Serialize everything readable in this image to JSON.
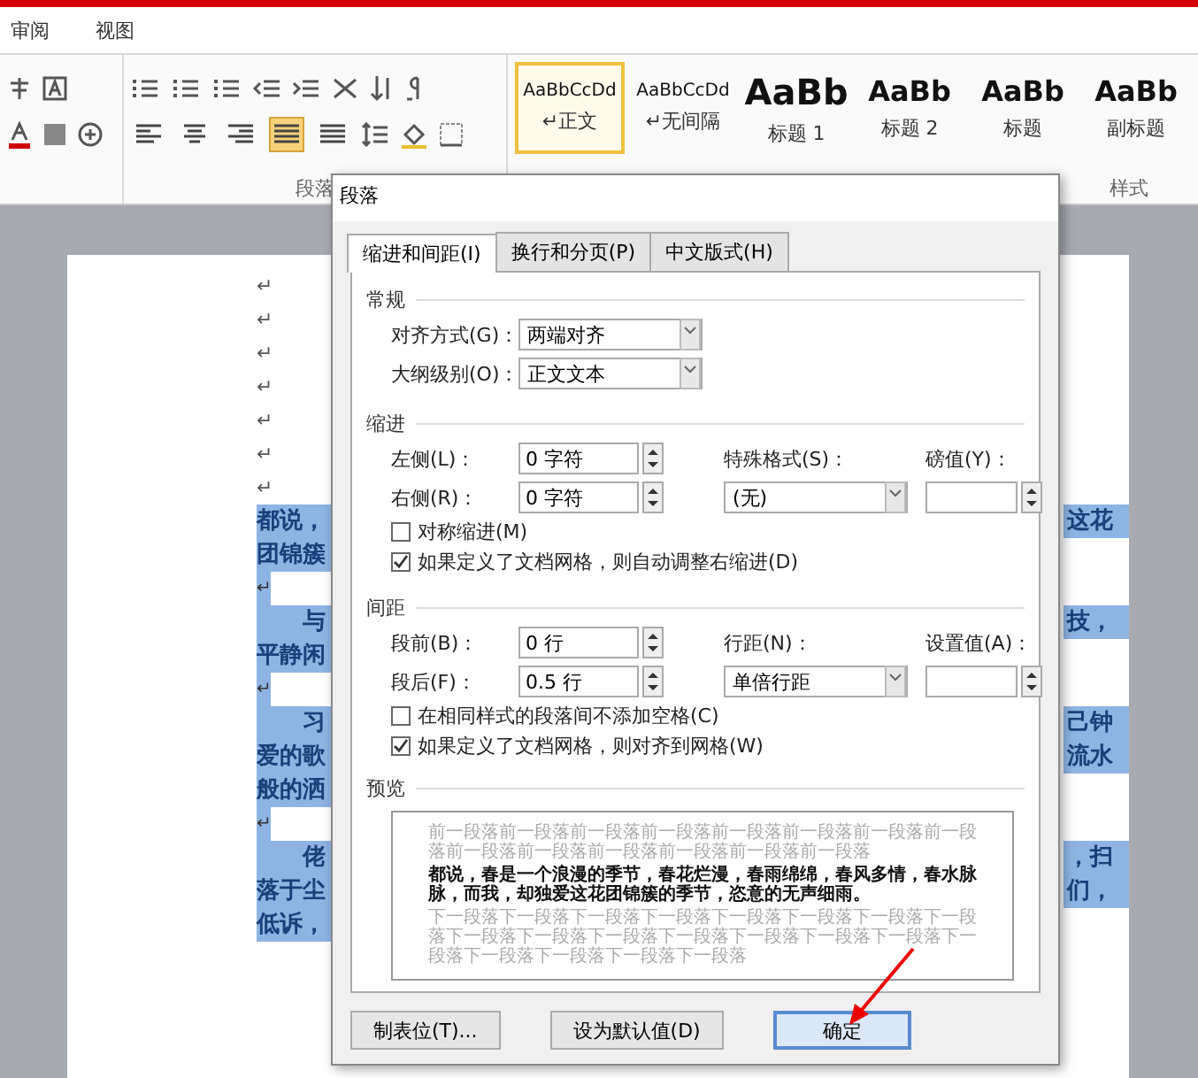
{
  "menu_tabs": [
    {
      "label": "审阅",
      "selected": false
    },
    {
      "label": "视图",
      "selected": false
    }
  ],
  "ribbon": {
    "alignment_buttons": [
      {
        "selected": false
      },
      {
        "selected": false
      },
      {
        "selected": false
      },
      {
        "selected": true
      },
      {
        "selected": false
      }
    ],
    "styles": [
      {
        "sample": "AaBbCcDd",
        "label": "↵正文",
        "kind": "small",
        "selected": true
      },
      {
        "sample": "AaBbCcDd",
        "label": "↵无间隔",
        "kind": "small",
        "selected": false
      },
      {
        "sample": "AaBb",
        "label": "标题 1",
        "kind": "large",
        "selected": false
      },
      {
        "sample": "AaBb",
        "label": "标题 2",
        "kind": "medium",
        "selected": false
      },
      {
        "sample": "AaBb",
        "label": "标题",
        "kind": "medium",
        "selected": false
      },
      {
        "sample": "AaBb",
        "label": "副标题",
        "kind": "medium",
        "selected": false
      }
    ],
    "group_labels": [
      "段落",
      "样式"
    ]
  },
  "document": {
    "paragraph_marks": [
      "↵",
      "↵",
      "↵",
      "↵",
      "↵",
      "↵",
      "↵"
    ],
    "lines": [
      {
        "kind": "text",
        "left": "都说，",
        "right": "这花",
        "indent": false,
        "selected": true
      },
      {
        "kind": "text",
        "left": "团锦簇",
        "indent": false,
        "selected": true
      },
      {
        "kind": "blank",
        "left": "↵",
        "selected": true
      },
      {
        "kind": "text",
        "left": "与",
        "right": "技，",
        "indent": true,
        "selected": true
      },
      {
        "kind": "text",
        "left": "平静闲",
        "indent": false,
        "selected": true
      },
      {
        "kind": "blank",
        "left": "↵",
        "selected": true
      },
      {
        "kind": "text",
        "left": "习",
        "right": "己钟",
        "indent": true,
        "selected": true
      },
      {
        "kind": "text",
        "left": "爱的歌",
        "right": "流水",
        "indent": false,
        "selected": true
      },
      {
        "kind": "text",
        "left": "般的洒",
        "indent": false,
        "selected": true
      },
      {
        "kind": "blank",
        "left": "↵",
        "selected": true
      },
      {
        "kind": "text",
        "left": "佬",
        "right": "，扫",
        "indent": true,
        "selected": true
      },
      {
        "kind": "text",
        "left": "落于尘",
        "right": "们，",
        "indent": false,
        "selected": true
      },
      {
        "kind": "text",
        "left": "低诉，",
        "indent": false,
        "selected": true
      }
    ]
  },
  "dialog": {
    "title": "段落",
    "tabs": [
      {
        "label": "缩进和间距(I)",
        "selected": true
      },
      {
        "label": "换行和分页(P)",
        "selected": false
      },
      {
        "label": "中文版式(H)",
        "selected": false
      }
    ],
    "sections": [
      {
        "title": "常规",
        "rows": [
          [
            {
              "kind": "label",
              "text": "对齐方式(G)："
            },
            {
              "kind": "dropdown",
              "value": "两端对齐"
            }
          ],
          [
            {
              "kind": "label",
              "text": "大纲级别(O)："
            },
            {
              "kind": "dropdown",
              "value": "正文文本"
            }
          ]
        ]
      },
      {
        "title": "缩进",
        "rows": [
          [
            {
              "kind": "label",
              "text": "左侧(L)："
            },
            {
              "kind": "spinner",
              "value": "0 字符"
            },
            {
              "kind": "label",
              "text": "特殊格式(S)："
            },
            {
              "kind": "label",
              "text": "磅值(Y)："
            }
          ],
          [
            {
              "kind": "label",
              "text": "右侧(R)："
            },
            {
              "kind": "spinner",
              "value": "0 字符"
            },
            {
              "kind": "dropdown",
              "value": "(无)"
            },
            {
              "kind": "spinner"
            }
          ]
        ],
        "checkboxes": [
          {
            "label": "对称缩进(M)",
            "checked": false
          },
          {
            "label": "如果定义了文档网格，则自动调整右缩进(D)",
            "checked": true
          }
        ]
      },
      {
        "title": "间距",
        "rows": [
          [
            {
              "kind": "label",
              "text": "段前(B)："
            },
            {
              "kind": "spinner",
              "value": "0 行"
            },
            {
              "kind": "label",
              "text": "行距(N)："
            },
            {
              "kind": "label",
              "text": "设置值(A)："
            }
          ],
          [
            {
              "kind": "label",
              "text": "段后(F)："
            },
            {
              "kind": "spinner",
              "value": "0.5 行"
            },
            {
              "kind": "dropdown",
              "value": "单倍行距"
            },
            {
              "kind": "spinner"
            }
          ]
        ],
        "checkboxes": [
          {
            "label": "在相同样式的段落间不添加空格(C)",
            "checked": false
          },
          {
            "label": "如果定义了文档网格，则对齐到网格(W)",
            "checked": true
          }
        ]
      }
    ],
    "preview": {
      "title": "预览",
      "previous": "前一段落前一段落前一段落前一段落前一段落前一段落前一段落前一段落前一段落前一段落前一段落前一段落前一段落前一段落",
      "sample": "都说，春是一个浪漫的季节，春花烂漫，春雨绵绵，春风多情，春水脉脉，而我，却独爱这花团锦簇的季节，恣意的无声细雨。",
      "next": "下一段落下一段落下一段落下一段落下一段落下一段落下一段落下一段落下一段落下一段落下一段落下一段落下一段落下一段落下一段落下一段落下一段落下一段落下一段落下一段落"
    },
    "buttons": [
      {
        "label": "制表位(T)...",
        "default": false
      },
      {
        "label": "设为默认值(D)",
        "default": false
      },
      {
        "label": "确定",
        "default": true
      }
    ]
  }
}
